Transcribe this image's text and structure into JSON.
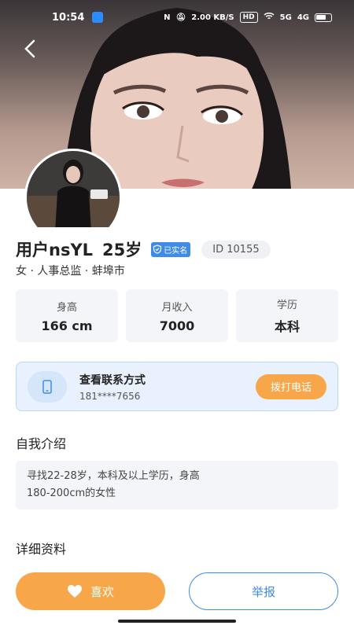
{
  "status_bar": {
    "time": "10:54",
    "net_speed": "2.00 KB/S",
    "hd": "HD",
    "signal1": "5G",
    "signal2": "4G"
  },
  "profile": {
    "name": "用户nsYL",
    "age": "25岁",
    "verified": "已实名",
    "id": "ID  10155",
    "sub_info": "女 · 人事总监 · 蚌埠市"
  },
  "stats": [
    {
      "label": "身高",
      "value": "166 cm"
    },
    {
      "label": "月收入",
      "value": "7000"
    },
    {
      "label": "学历",
      "value": "本科"
    }
  ],
  "contact": {
    "title": "查看联系方式",
    "phone": "181****7656",
    "call_label": "拨打电话"
  },
  "intro": {
    "title": "自我介绍",
    "text_line1": "寻找22-28岁，本科及以上学历，身高",
    "text_line2": "180-200cm的女性"
  },
  "details": {
    "title": "详细资料"
  },
  "actions": {
    "like_label": "喜欢",
    "report_label": "举报"
  },
  "colors": {
    "accent_orange": "#f7a74a",
    "accent_blue": "#3f8be8"
  }
}
